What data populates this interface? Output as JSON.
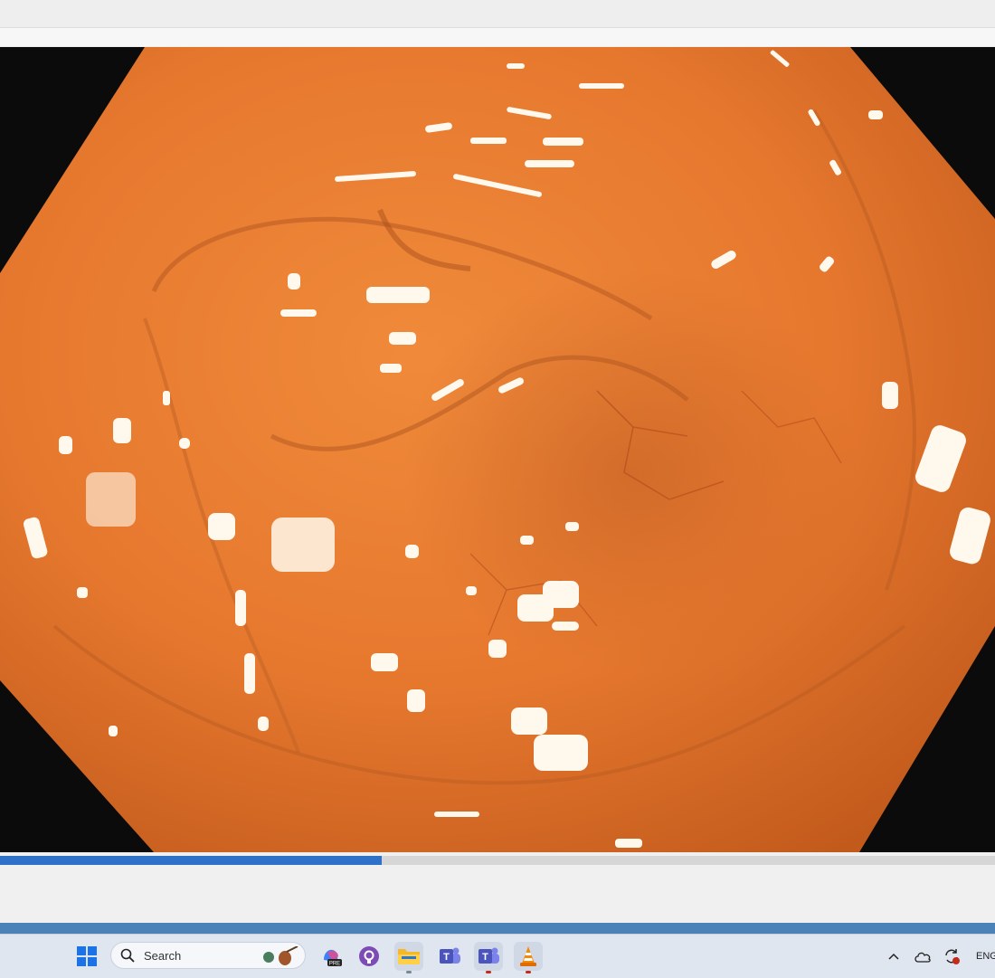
{
  "window": {
    "title": ""
  },
  "video": {
    "progress_percent": 38.4,
    "content": "endoscopy-frame"
  },
  "taskbar": {
    "search_placeholder": "Search",
    "apps": [
      {
        "name": "start-button",
        "icon": "windows-logo-icon"
      },
      {
        "name": "copilot",
        "icon": "copilot-pre-icon",
        "badge": "PRE"
      },
      {
        "name": "github-desktop",
        "icon": "github-icon"
      },
      {
        "name": "file-explorer",
        "icon": "folder-icon"
      },
      {
        "name": "teams-classic",
        "icon": "teams-icon"
      },
      {
        "name": "teams",
        "icon": "teams-icon"
      },
      {
        "name": "vlc",
        "icon": "vlc-cone-icon"
      }
    ],
    "tray": {
      "language": "ENG"
    }
  },
  "colors": {
    "accent": "#2f71c9",
    "video_background": "#0b0b0b",
    "tissue": "#e6782e",
    "taskbar": "#dfe6ef"
  }
}
